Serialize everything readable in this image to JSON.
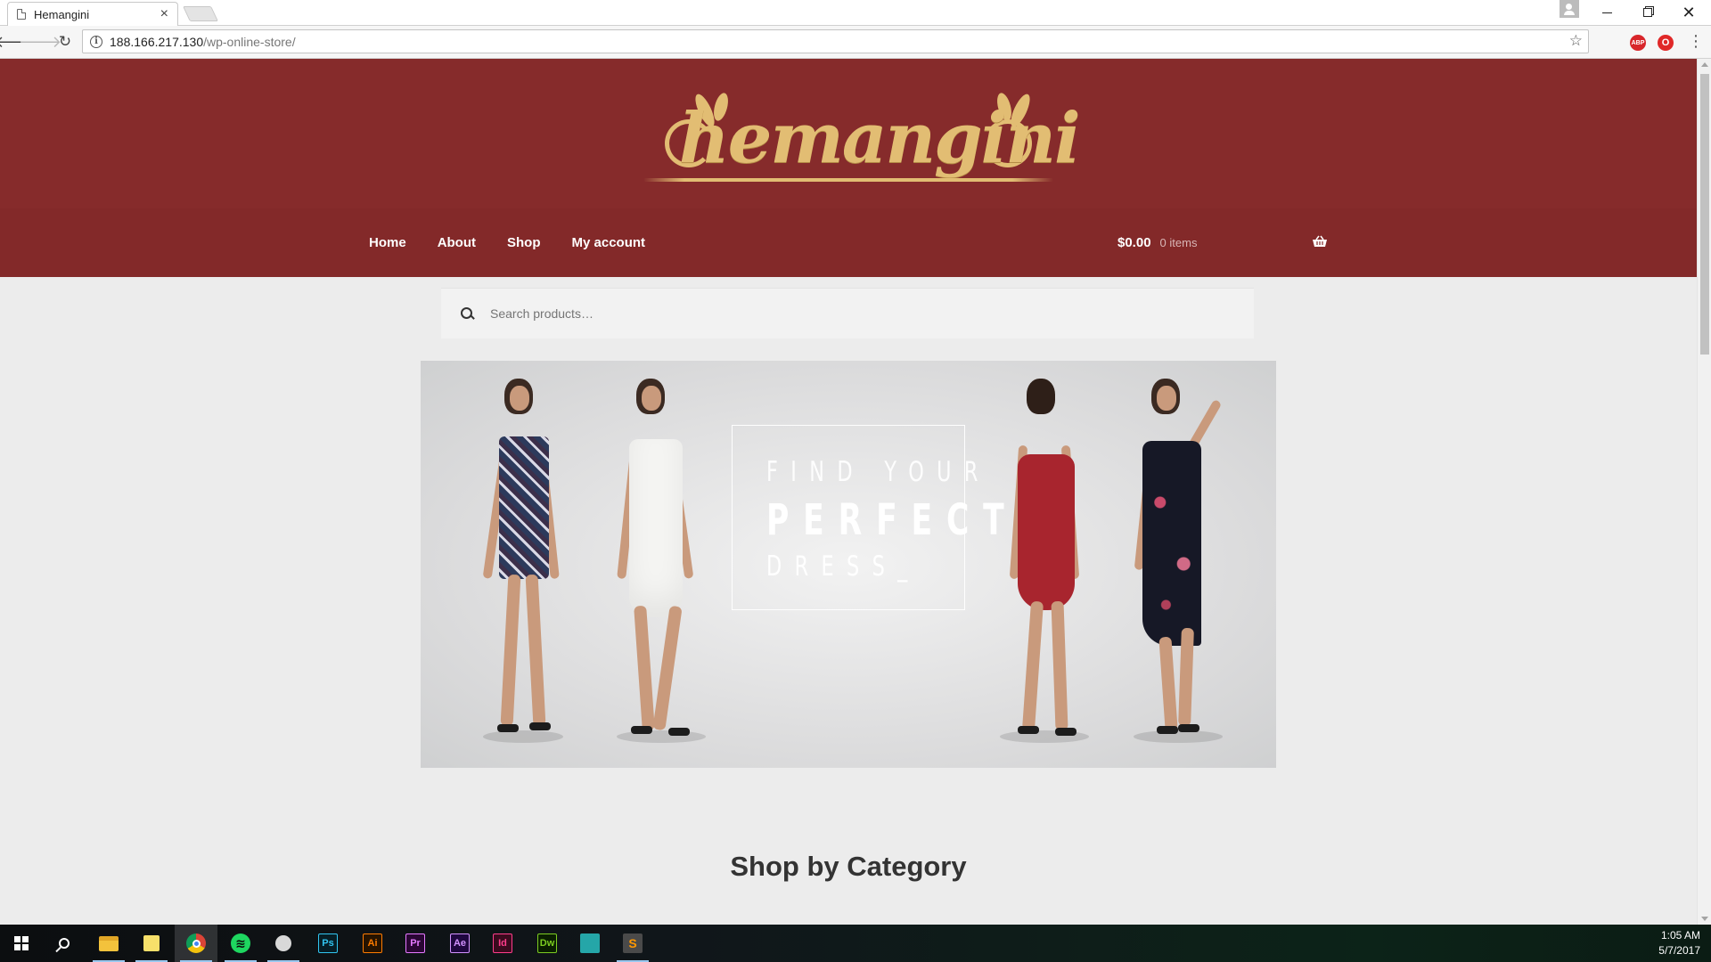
{
  "browser": {
    "tab_title": "Hemangini",
    "tab_close": "×",
    "url_host": "188.166.217.130",
    "url_path": "/wp-online-store/",
    "extensions": [
      "ABP",
      "O"
    ]
  },
  "site": {
    "logo_text": "hemangini",
    "nav": {
      "home": "Home",
      "about": "About",
      "shop": "Shop",
      "my_account": "My account"
    },
    "cart": {
      "amount": "$0.00",
      "items": "0 items"
    },
    "search": {
      "placeholder": "Search products…"
    },
    "hero": {
      "line1": "FIND YOUR",
      "line2": "PERFECT",
      "line3": "DRESS_"
    },
    "section_title": "Shop by Category"
  },
  "taskbar": {
    "apps": [
      {
        "name": "file-explorer",
        "label": ""
      },
      {
        "name": "sticky-notes",
        "label": ""
      },
      {
        "name": "chrome",
        "label": ""
      },
      {
        "name": "spotify",
        "label": ""
      },
      {
        "name": "inkscape",
        "label": ""
      },
      {
        "name": "photoshop",
        "label": "Ps"
      },
      {
        "name": "illustrator",
        "label": "Ai"
      },
      {
        "name": "premiere",
        "label": "Pr"
      },
      {
        "name": "after-effects",
        "label": "Ae"
      },
      {
        "name": "indesign",
        "label": "Id"
      },
      {
        "name": "dreamweaver",
        "label": "Dw"
      },
      {
        "name": "app-teal",
        "label": ""
      },
      {
        "name": "sublime-text",
        "label": ""
      }
    ],
    "time": "1:05 AM",
    "date": "5/7/2017"
  },
  "colors": {
    "header_bg": "#862b2b",
    "logo_gold": "#e2bd73",
    "page_bg": "#ececec"
  }
}
